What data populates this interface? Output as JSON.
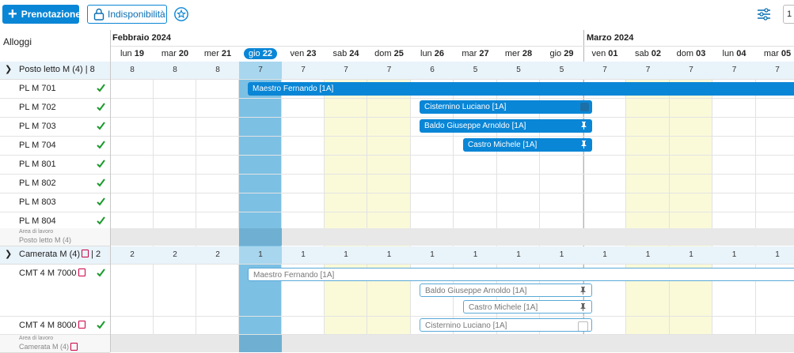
{
  "toolbar": {
    "new_label": "Prenotazione",
    "unavail_label": "Indisponibilità",
    "pager_value": "1",
    "accent": "#0a86d6"
  },
  "left": {
    "header": "Alloggi",
    "groups": [
      {
        "label": "Posto letto M (4) | 8",
        "rooms": [
          "PL M 701",
          "PL M 702",
          "PL M 703",
          "PL M 704",
          "PL M 801",
          "PL M 802",
          "PL M 803",
          "PL M 804"
        ],
        "area_line1": "Area di lavoro",
        "area_line2": "Posto letto M (4)"
      },
      {
        "label_a": "Camerata M (4)",
        "label_b": "| 2",
        "rooms": [
          "CMT 4 M 7000",
          "CMT 4 M 8000"
        ],
        "area_line1": "Area di lavoro",
        "area_line2": "Camerata M (4)"
      }
    ]
  },
  "calendar": {
    "months": [
      "Febbraio 2024",
      "Marzo 2024"
    ],
    "days": [
      {
        "dow": "lun",
        "num": "19"
      },
      {
        "dow": "mar",
        "num": "20"
      },
      {
        "dow": "mer",
        "num": "21"
      },
      {
        "dow": "gio",
        "num": "22"
      },
      {
        "dow": "ven",
        "num": "23"
      },
      {
        "dow": "sab",
        "num": "24"
      },
      {
        "dow": "dom",
        "num": "25"
      },
      {
        "dow": "lun",
        "num": "26"
      },
      {
        "dow": "mar",
        "num": "27"
      },
      {
        "dow": "mer",
        "num": "28"
      },
      {
        "dow": "gio",
        "num": "29"
      },
      {
        "dow": "ven",
        "num": "01"
      },
      {
        "dow": "sab",
        "num": "02"
      },
      {
        "dow": "dom",
        "num": "03"
      },
      {
        "dow": "lun",
        "num": "04"
      },
      {
        "dow": "mar",
        "num": "05"
      }
    ],
    "group1_counts": [
      "8",
      "8",
      "8",
      "7",
      "7",
      "7",
      "7",
      "6",
      "5",
      "5",
      "5",
      "7",
      "7",
      "7",
      "7",
      "7"
    ],
    "group2_counts": [
      "2",
      "2",
      "2",
      "1",
      "1",
      "1",
      "1",
      "1",
      "1",
      "1",
      "1",
      "1",
      "1",
      "1",
      "1",
      "1"
    ]
  },
  "bookings": {
    "b1": "Maestro Fernando [1A]",
    "b2": "Cisternino Luciano [1A]",
    "b3": "Baldo Giuseppe Arnoldo [1A]",
    "b4": "Castro Michele [1A]",
    "g1": "Maestro Fernando [1A]",
    "g2": "Baldo Giuseppe Arnoldo [1A]",
    "g3": "Castro Michele [1A]",
    "g4": "Cisternino Luciano [1A]"
  }
}
